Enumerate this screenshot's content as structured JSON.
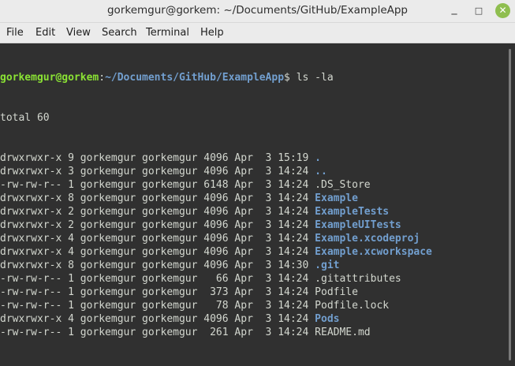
{
  "window": {
    "title": "gorkemgur@gorkem: ~/Documents/GitHub/ExampleApp",
    "minimize_glyph": "_",
    "maximize_glyph": "□",
    "close_glyph": "✕"
  },
  "menu": [
    "File",
    "Edit",
    "View",
    "Search",
    "Terminal",
    "Help"
  ],
  "prompt": {
    "user_host": "gorkemgur@gorkem",
    "separator": ":",
    "path": "~/Documents/GitHub/ExampleApp",
    "symbol": "$ "
  },
  "command": "ls -la",
  "total_line": "total 60",
  "listing": [
    {
      "meta": "drwxrwxr-x 9 gorkemgur gorkemgur 4096 Apr  3 15:19 ",
      "name": ".",
      "is_dir": true
    },
    {
      "meta": "drwxrwxr-x 3 gorkemgur gorkemgur 4096 Apr  3 14:24 ",
      "name": "..",
      "is_dir": true
    },
    {
      "meta": "-rw-rw-r-- 1 gorkemgur gorkemgur 6148 Apr  3 14:24 ",
      "name": ".DS_Store",
      "is_dir": false
    },
    {
      "meta": "drwxrwxr-x 8 gorkemgur gorkemgur 4096 Apr  3 14:24 ",
      "name": "Example",
      "is_dir": true
    },
    {
      "meta": "drwxrwxr-x 2 gorkemgur gorkemgur 4096 Apr  3 14:24 ",
      "name": "ExampleTests",
      "is_dir": true
    },
    {
      "meta": "drwxrwxr-x 2 gorkemgur gorkemgur 4096 Apr  3 14:24 ",
      "name": "ExampleUITests",
      "is_dir": true
    },
    {
      "meta": "drwxrwxr-x 4 gorkemgur gorkemgur 4096 Apr  3 14:24 ",
      "name": "Example.xcodeproj",
      "is_dir": true
    },
    {
      "meta": "drwxrwxr-x 4 gorkemgur gorkemgur 4096 Apr  3 14:24 ",
      "name": "Example.xcworkspace",
      "is_dir": true
    },
    {
      "meta": "drwxrwxr-x 8 gorkemgur gorkemgur 4096 Apr  3 14:30 ",
      "name": ".git",
      "is_dir": true
    },
    {
      "meta": "-rw-rw-r-- 1 gorkemgur gorkemgur   66 Apr  3 14:24 ",
      "name": ".gitattributes",
      "is_dir": false
    },
    {
      "meta": "-rw-rw-r-- 1 gorkemgur gorkemgur  373 Apr  3 14:24 ",
      "name": "Podfile",
      "is_dir": false
    },
    {
      "meta": "-rw-rw-r-- 1 gorkemgur gorkemgur   78 Apr  3 14:24 ",
      "name": "Podfile.lock",
      "is_dir": false
    },
    {
      "meta": "drwxrwxr-x 4 gorkemgur gorkemgur 4096 Apr  3 14:24 ",
      "name": "Pods",
      "is_dir": true
    },
    {
      "meta": "-rw-rw-r-- 1 gorkemgur gorkemgur  261 Apr  3 14:24 ",
      "name": "README.md",
      "is_dir": false
    }
  ],
  "colors": {
    "background": "#303030",
    "foreground": "#d3d7cf",
    "prompt_user": "#8ae234",
    "prompt_path": "#729fcf",
    "directory": "#729fcf",
    "close_button": "#8fbe4f"
  },
  "icons": {
    "minimize": "minimize-icon",
    "maximize": "maximize-icon",
    "close": "close-icon"
  }
}
